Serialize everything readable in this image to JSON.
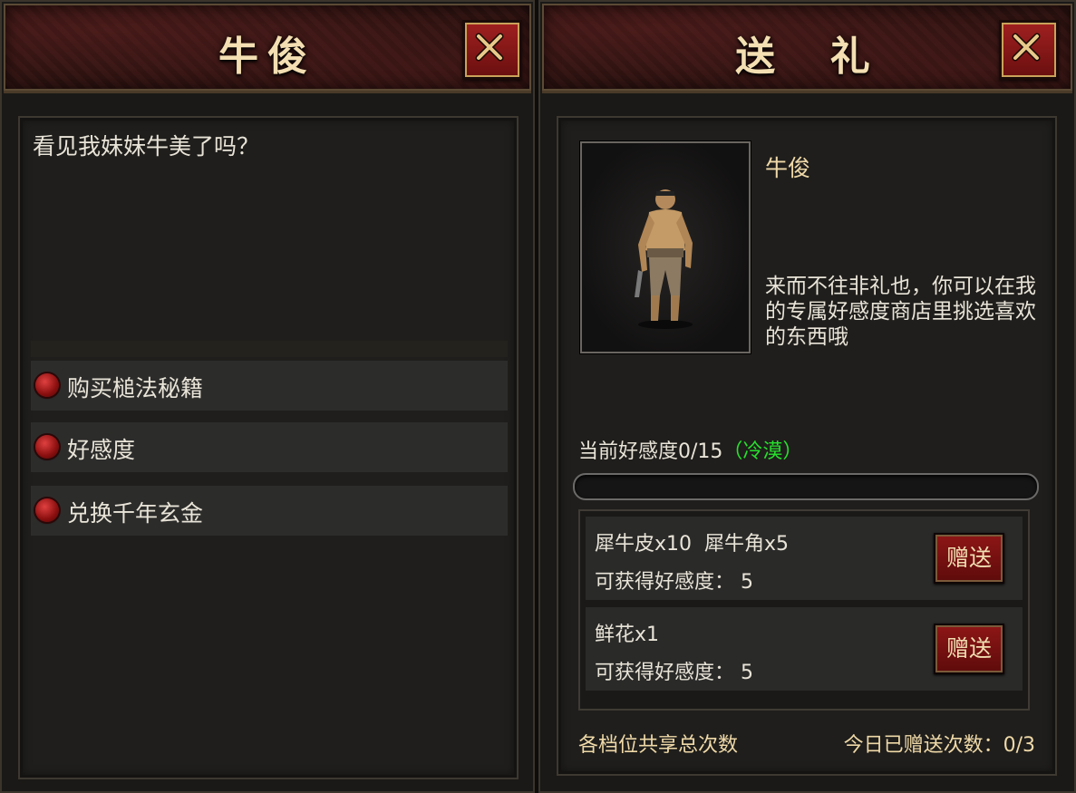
{
  "npc_panel": {
    "title": "牛俊",
    "dialog": "看见我妹妹牛美了吗？",
    "options": [
      {
        "label": "购买槌法秘籍"
      },
      {
        "label": "好感度"
      },
      {
        "label": "兑换千年玄金"
      }
    ]
  },
  "gift_panel": {
    "title": "送  礼",
    "npc_name": "牛俊",
    "description": "来而不往非礼也，你可以在我的专属好感度商店里挑选喜欢的东西哦",
    "favor_label": "当前好感度0/15",
    "favor_status": "（冷漠）",
    "favor_progress": 0,
    "gifts": [
      {
        "items": "犀牛皮x10  犀牛角x5",
        "gain": "可获得好感度： 5",
        "button": "赠送"
      },
      {
        "items": "鲜花x1",
        "gain": "可获得好感度： 5",
        "button": "赠送"
      }
    ],
    "footer_left": "各档位共享总次数",
    "footer_right": "今日已赠送次数：0/3"
  },
  "colors": {
    "title_gold": "#f3dfb2",
    "status_green": "#27e02d",
    "button_red": "#8e1616"
  },
  "icons": {
    "close": "close-x-icon",
    "bullet": "red-orb-bullet-icon",
    "portrait": "npc-portrait"
  }
}
